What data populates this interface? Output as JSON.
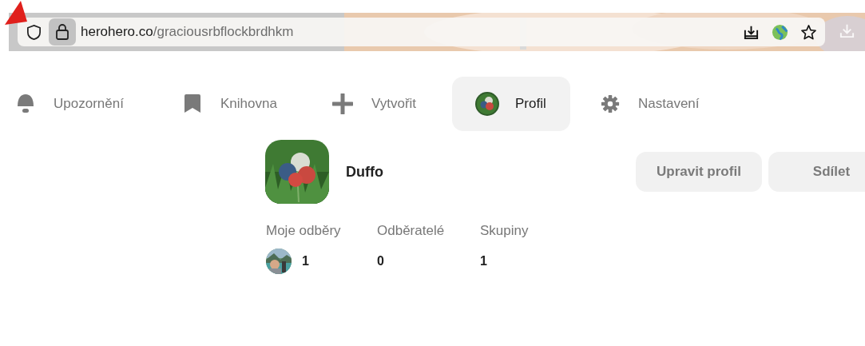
{
  "browser": {
    "url_host": "herohero.co",
    "url_path": "/graciousrbflockbrdhkm"
  },
  "nav": [
    {
      "kind": "bell",
      "label": "Upozornění",
      "selected": false
    },
    {
      "kind": "bookmark",
      "label": "Knihovna",
      "selected": false
    },
    {
      "kind": "plus",
      "label": "Vytvořit",
      "selected": false
    },
    {
      "kind": "avatar",
      "label": "Profil",
      "selected": true
    },
    {
      "kind": "gear",
      "label": "Nastavení",
      "selected": false
    }
  ],
  "profile": {
    "name": "Duffo",
    "buttons": [
      "Upravit profil",
      "Sdílet"
    ]
  },
  "stats": [
    {
      "label": "Moje odběry",
      "value": "1",
      "avatar": true
    },
    {
      "label": "Odběratelé",
      "value": "0",
      "avatar": false
    },
    {
      "label": "Skupiny",
      "value": "1",
      "avatar": false
    }
  ]
}
